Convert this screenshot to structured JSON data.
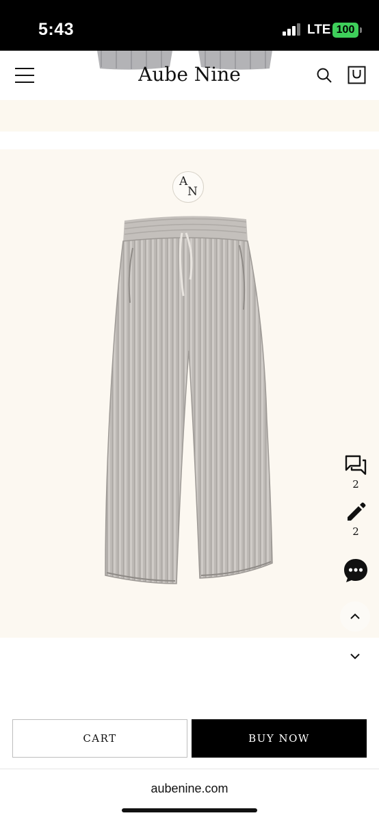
{
  "status_bar": {
    "time": "5:43",
    "network": "LTE",
    "battery": "100"
  },
  "header": {
    "brand": "Aube Nine"
  },
  "product": {
    "logo_letters": [
      "A",
      "N"
    ]
  },
  "side_actions": {
    "qa_count": "2",
    "review_count": "2"
  },
  "actions": {
    "cart_label": "CART",
    "buy_label": "BUY NOW"
  },
  "browser": {
    "url": "aubenine.com"
  },
  "colors": {
    "cream": "#fcf8f1",
    "battery_green": "#3ecf5a",
    "primary_button": "#000000"
  },
  "icons": {
    "menu": "hamburger-icon",
    "search": "search-icon",
    "bag": "shopping-bag-icon",
    "qa": "chat-bubbles-icon",
    "review": "pencil-icon",
    "chat": "chat-dots-icon",
    "up": "chevron-up-icon",
    "down": "chevron-down-icon"
  }
}
